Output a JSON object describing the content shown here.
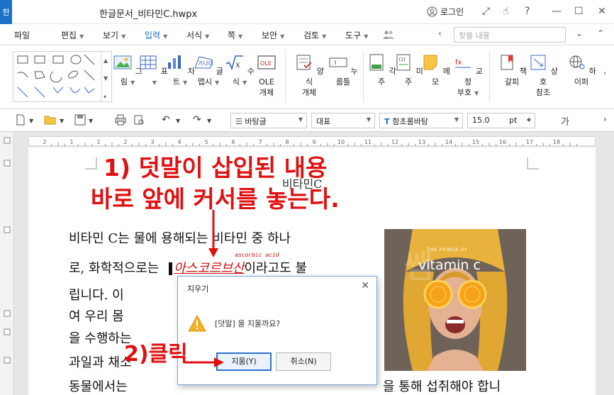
{
  "window": {
    "title": "한글문서_비타민C.hwpx",
    "login_label": "로그인",
    "app_icon": "한",
    "controls": {
      "expand": "⤢",
      "hand": "☝",
      "help": "?",
      "minimize": "—",
      "maximize": "☐",
      "close": "✕"
    }
  },
  "menu": {
    "file": "파일",
    "edit": "편집",
    "view": "보기",
    "insert": "입력",
    "format": "서식",
    "page": "쪽",
    "security": "보안",
    "review": "검토",
    "tools": "도구",
    "search_placeholder": "찾을 내용"
  },
  "ribbon": {
    "buttons": [
      {
        "id": "picture",
        "label": "그림",
        "has_dropdown": true
      },
      {
        "id": "table",
        "label": "표",
        "has_dropdown": true
      },
      {
        "id": "chart",
        "label": "차트",
        "has_dropdown": true
      },
      {
        "id": "wordart",
        "label": "글맵시",
        "has_dropdown": true
      },
      {
        "id": "equation",
        "label": "수식",
        "has_dropdown": true
      },
      {
        "id": "ole",
        "label": "OLE\n개체"
      },
      {
        "id": "form",
        "label": "양식\n개체",
        "has_dropdown": true
      },
      {
        "id": "pushbutton",
        "label": "누름틀"
      },
      {
        "id": "footnote",
        "label": "각주"
      },
      {
        "id": "endnote",
        "label": "미주"
      },
      {
        "id": "memo",
        "label": "메모"
      },
      {
        "id": "proof",
        "label": "교정\n부호",
        "has_dropdown": true
      },
      {
        "id": "bookmark",
        "label": "책갈피"
      },
      {
        "id": "crossref",
        "label": "상호\n참조"
      },
      {
        "id": "hyperlink",
        "label": "하이퍼"
      }
    ]
  },
  "format_bar": {
    "style": "바탕글",
    "outline": "대표",
    "font": "함초롬바탕",
    "font_size": "15.0",
    "unit": "pt",
    "char": "가"
  },
  "ruler": {
    "marks": [
      "2",
      "1",
      "1",
      "2",
      "3",
      "4",
      "5",
      "6",
      "7",
      "8",
      "9",
      "10",
      "11",
      "12",
      "13",
      "14",
      "15",
      "16",
      "17",
      "18"
    ]
  },
  "document": {
    "heading": "비타민C",
    "lines": [
      "비타민 C는 물에 용해되는 비타민 중 하나",
      "로, 화학적으로는",
      "립니다. 이",
      "여 우리 몸",
      "을 수행하는",
      "과일과 채소",
      "동물에서는",
      "을 통해 섭취해야 합니"
    ],
    "footnote_word": "아스코르브산",
    "footnote_rest": "이라고도 불",
    "footnote_annotation": "ascorbic acid",
    "image_caption_small": "THE POWER OF",
    "image_caption": "vitamin c",
    "watermark": "쌤"
  },
  "dialog": {
    "title": "지우기",
    "message": "[덧말] 을 지울까요?",
    "ok_label": "지움(Y)",
    "cancel_label": "취소(N)"
  },
  "annotations": {
    "step1_line1": "1) 덧말이 삽입된 내용",
    "step1_line2": "바로 앞에 커서를 놓는다.",
    "step2": "2)클릭",
    "color": "#e01010"
  },
  "colors": {
    "accent": "#1a6fc9",
    "annotation": "#e01010",
    "dialog_border": "#7aa6d8",
    "primary_button_border": "#2d6fd0"
  }
}
